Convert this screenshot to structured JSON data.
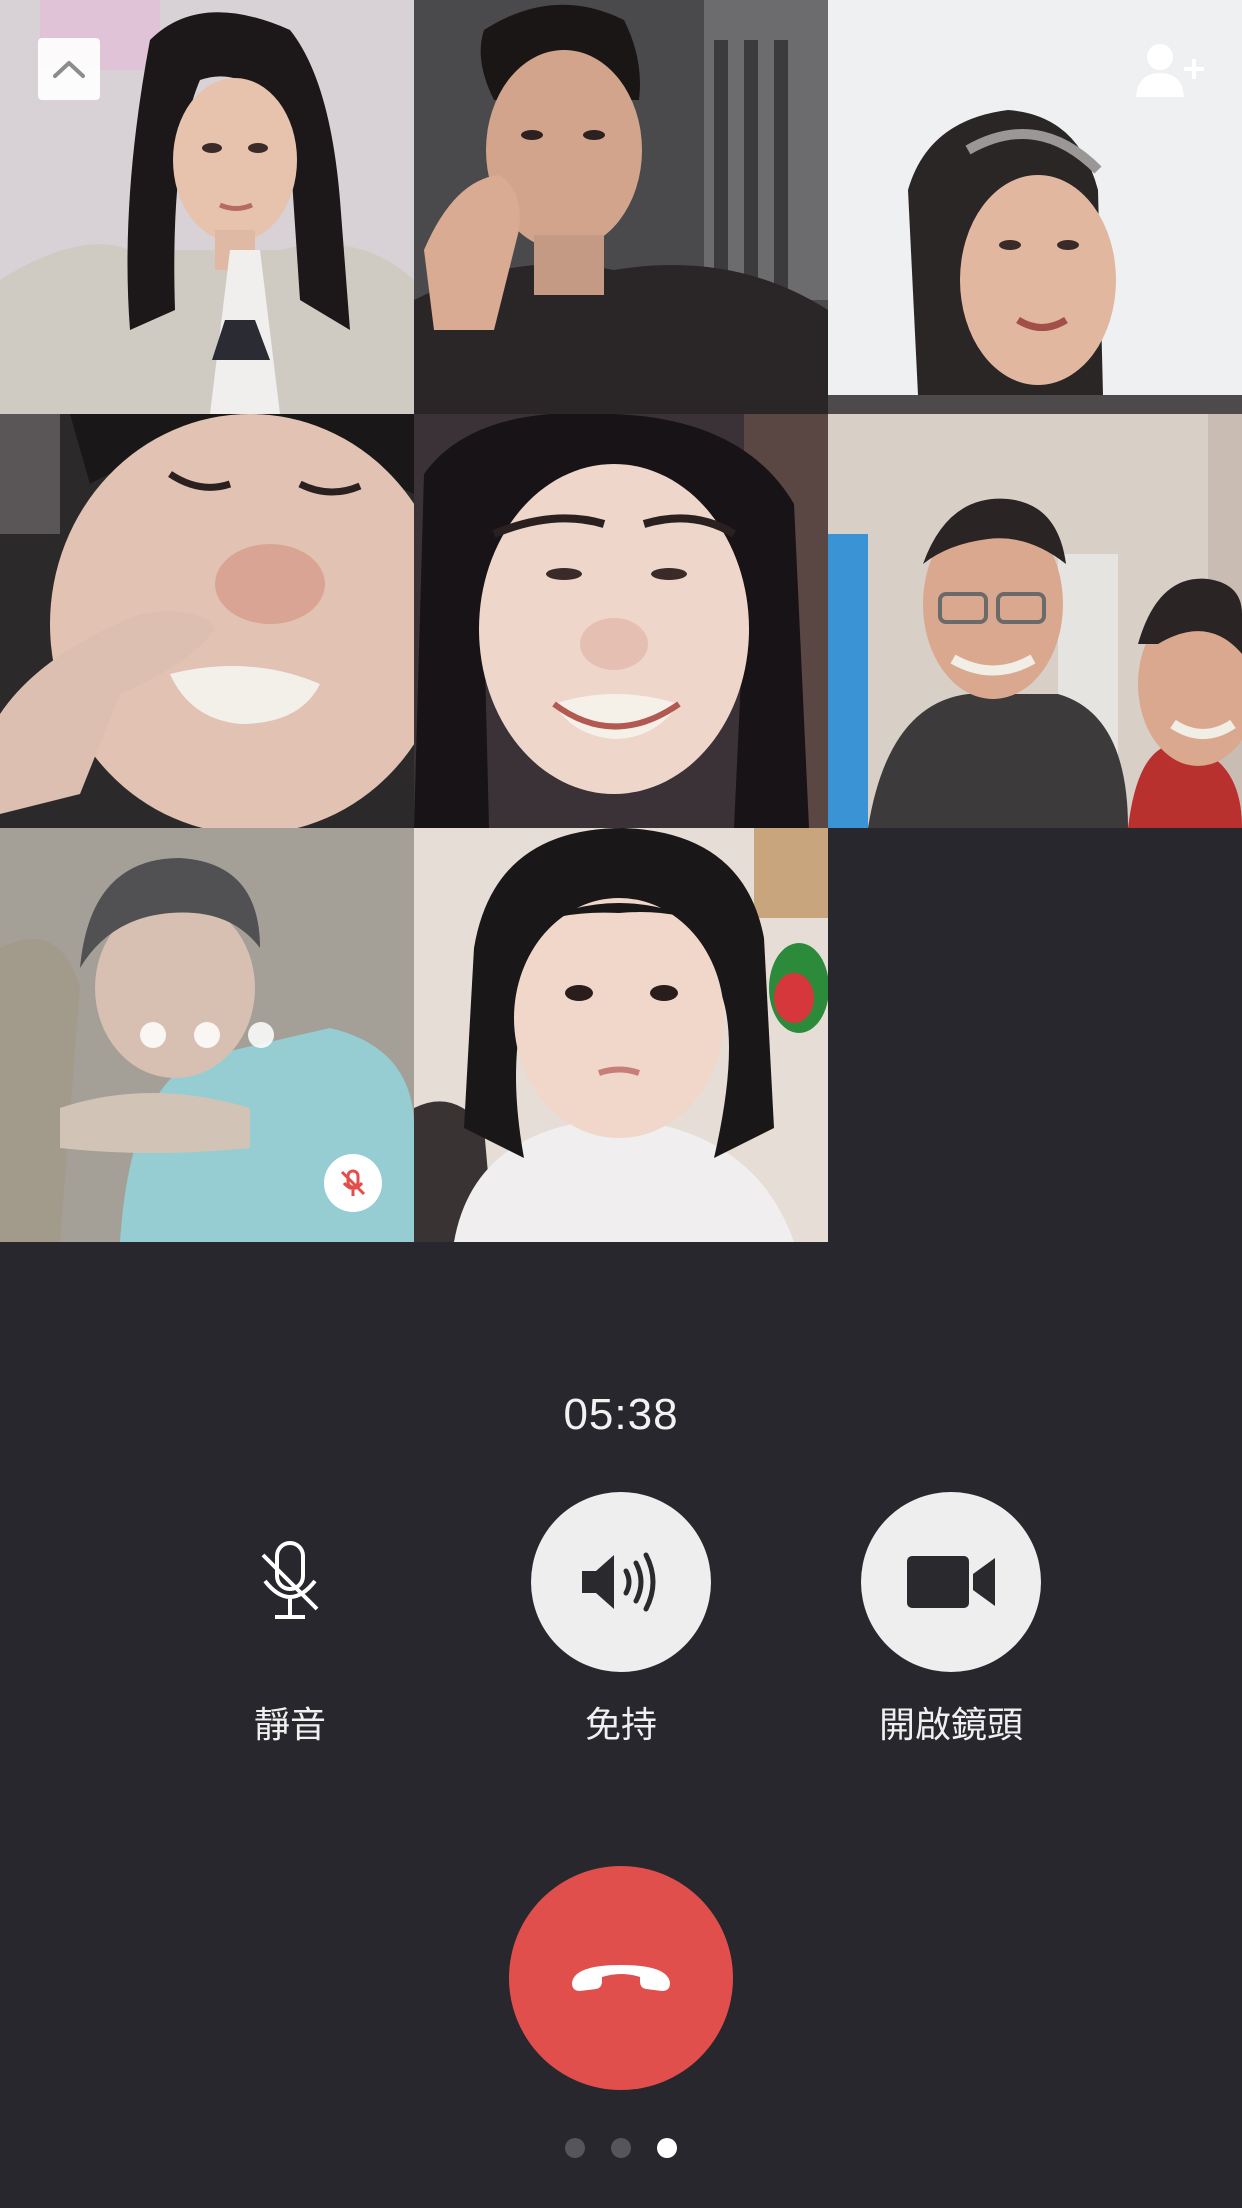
{
  "call": {
    "elapsed": "05:38"
  },
  "participants": [
    {
      "icon": "participant-video-woman-long-hair"
    },
    {
      "icon": "participant-video-man-hand-on-face"
    },
    {
      "icon": "participant-video-older-woman"
    },
    {
      "icon": "participant-video-girl-finger-on-nose"
    },
    {
      "icon": "participant-video-woman-smiling"
    },
    {
      "icon": "participant-video-couple-smiling"
    },
    {
      "icon": "participant-video-boy-connecting",
      "status": "connecting",
      "muted": true
    },
    {
      "icon": "participant-video-toddler"
    }
  ],
  "controls": {
    "mute_label": "靜音",
    "speaker_label": "免持",
    "camera_label": "開啟鏡頭"
  },
  "pager": {
    "count": 3,
    "active_index": 2
  },
  "colors": {
    "background": "#28272d",
    "hangup": "#e14f4c",
    "control_fill": "#eeeeee",
    "muted_badge_icon": "#e14f4c"
  }
}
